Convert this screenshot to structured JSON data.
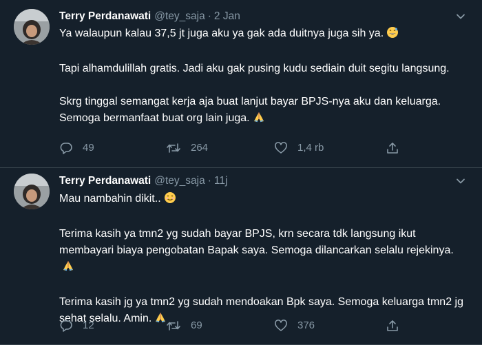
{
  "theme": {
    "background": "#15202b",
    "text": "#ffffff",
    "muted": "#8899a6",
    "divider": "#38444d"
  },
  "tweets": [
    {
      "author_name": "Terry Perdanawati",
      "handle": "@tey_saja",
      "separator": "·",
      "date": "2 Jan",
      "paragraphs": [
        "Ya walaupun kalau 37,5 jt juga aku ya gak ada duitnya juga sih ya.",
        "Tapi alhamdulillah gratis. Jadi aku gak pusing kudu sediain duit segitu langsung.",
        "Skrg tinggal semangat kerja aja buat lanjut bayar BPJS-nya aku dan keluarga. Semoga bermanfaat buat org lain juga."
      ],
      "replies": "49",
      "retweets": "264",
      "likes": "1,4 rb"
    },
    {
      "author_name": "Terry Perdanawati",
      "handle": "@tey_saja",
      "separator": "·",
      "date": "11j",
      "paragraphs": [
        "Mau nambahin dikit..",
        "Terima kasih ya tmn2 yg sudah bayar BPJS, krn secara tdk langsung ikut membayari biaya pengobatan Bapak saya. Semoga dilancarkan selalu rejekinya.",
        "Terima kasih jg ya tmn2 yg sudah mendoakan Bpk saya. Semoga keluarga tmn2 jg sehat selalu. Amin."
      ],
      "replies": "12",
      "retweets": "69",
      "likes": "376"
    }
  ],
  "icons": {
    "reply": "reply-icon",
    "retweet": "retweet-icon",
    "like": "heart-icon",
    "share": "share-icon",
    "caret": "chevron-down-icon",
    "emoji_grin_sweat": "grinning-sweat-emoji",
    "emoji_pray": "folded-hands-emoji",
    "emoji_smile": "smiling-face-emoji"
  }
}
